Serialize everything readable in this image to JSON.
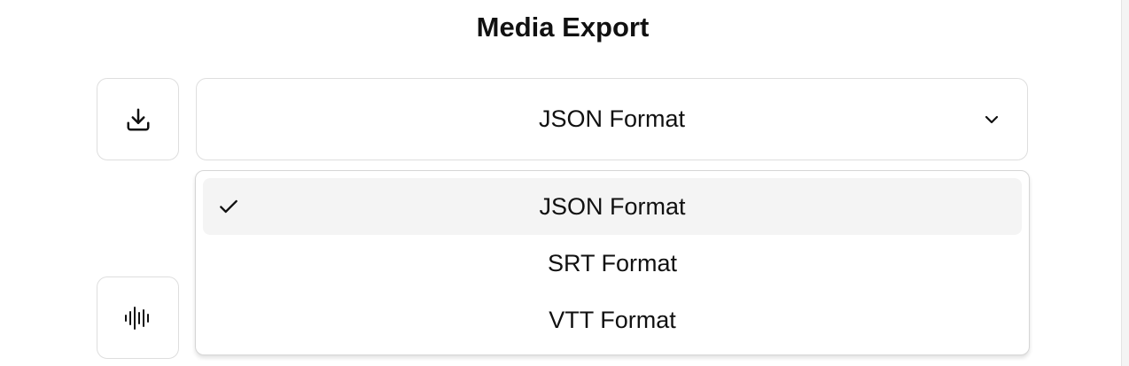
{
  "header": {
    "title": "Media Export"
  },
  "actions": {
    "download_icon": "download-icon",
    "audio_icon": "audio-waveform-icon"
  },
  "format_select": {
    "selected_value": "JSON Format",
    "options": [
      {
        "label": "JSON Format",
        "selected": true
      },
      {
        "label": "SRT Format",
        "selected": false
      },
      {
        "label": "VTT Format",
        "selected": false
      }
    ]
  },
  "colors": {
    "border": "#dedede",
    "selected_option_bg": "#f4f4f4",
    "text": "#111111"
  }
}
